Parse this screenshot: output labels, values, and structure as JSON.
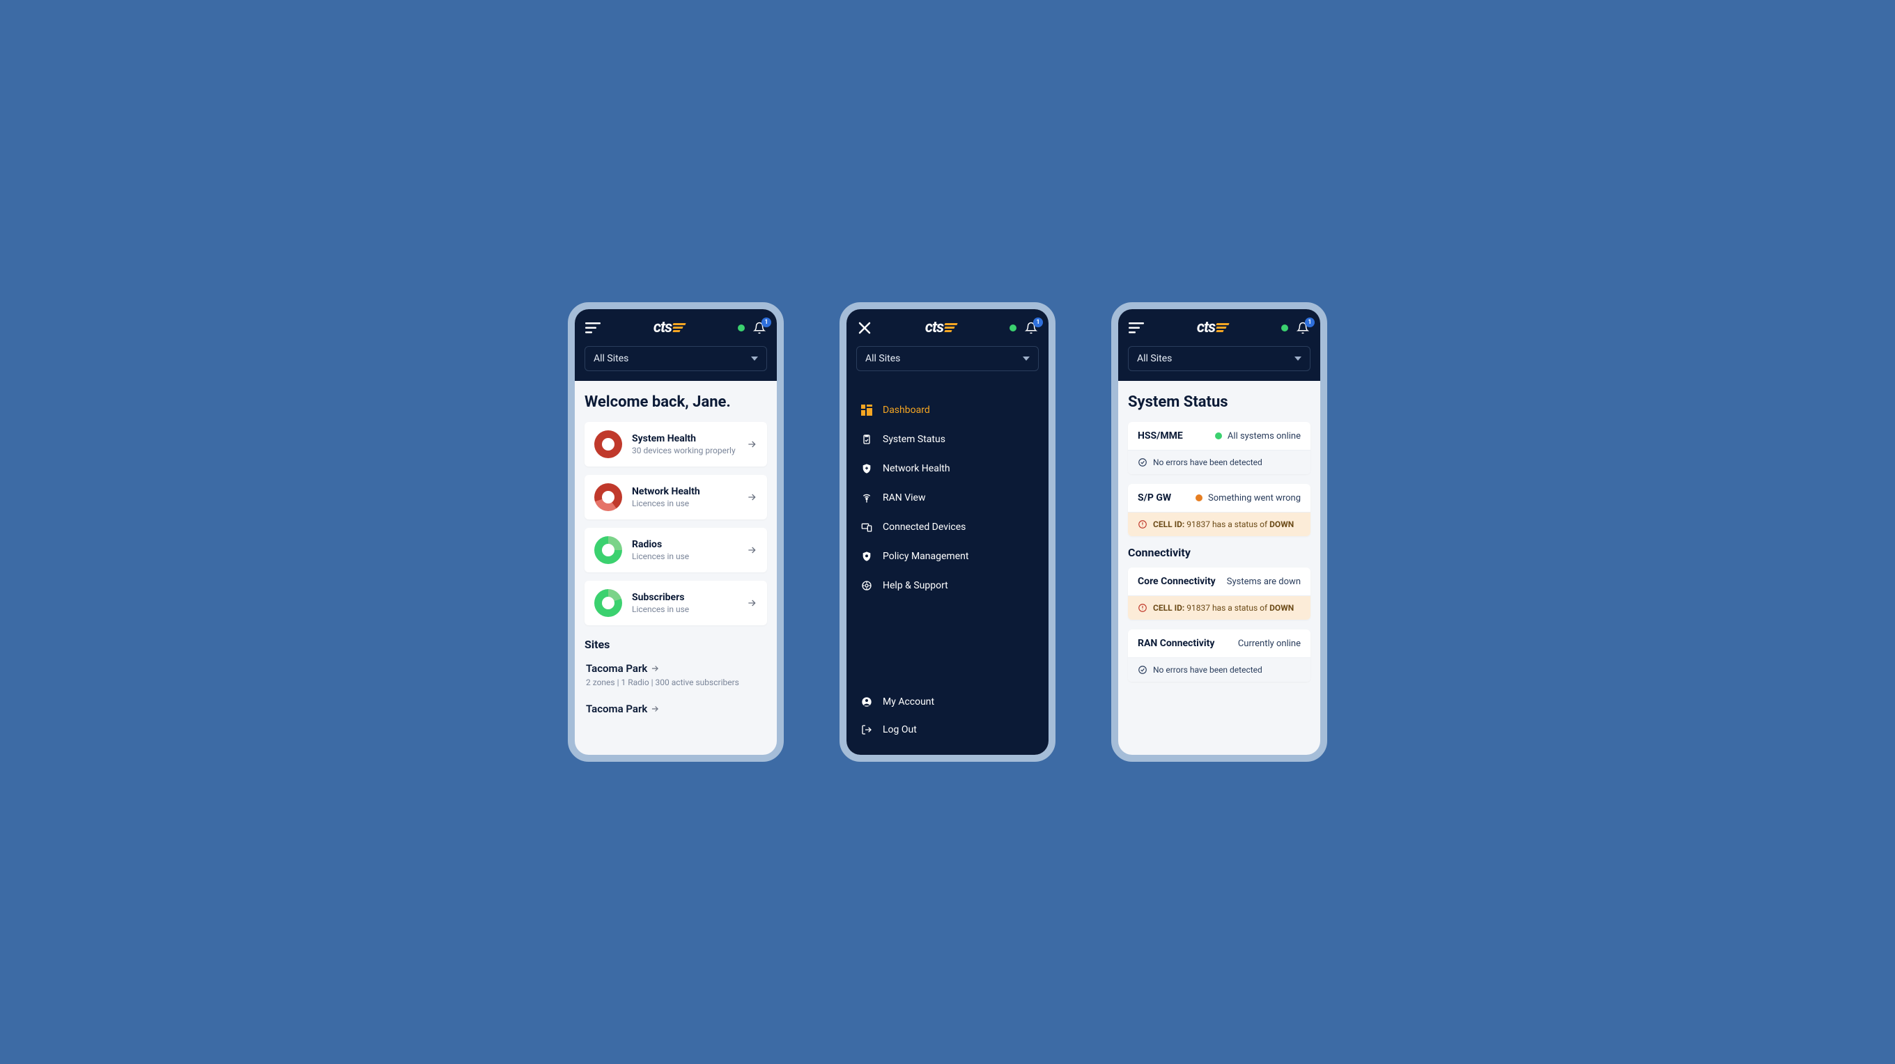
{
  "brand": "cts",
  "notification_count": "1",
  "site_select": {
    "label": "All Sites"
  },
  "dashboard": {
    "welcome": "Welcome back, Jane.",
    "cards": [
      {
        "title": "System Health",
        "sub": "30 devices working properly"
      },
      {
        "title": "Network Health",
        "sub": "Licences in use"
      },
      {
        "title": "Radios",
        "sub": "Licences in use"
      },
      {
        "title": "Subscribers",
        "sub": "Licences in use"
      }
    ],
    "sites_heading": "Sites",
    "sites": [
      {
        "name": "Tacoma Park",
        "sub": "2 zones  | 1 Radio  |  300 active subscribers"
      },
      {
        "name": "Tacoma Park",
        "sub": ""
      }
    ]
  },
  "nav": {
    "items": [
      {
        "label": "Dashboard"
      },
      {
        "label": "System Status"
      },
      {
        "label": "Network Health"
      },
      {
        "label": "RAN View"
      },
      {
        "label": "Connected Devices"
      },
      {
        "label": "Policy Management"
      },
      {
        "label": "Help & Support"
      }
    ],
    "bottom": [
      {
        "label": "My Account"
      },
      {
        "label": "Log Out"
      }
    ]
  },
  "status": {
    "title": "System Status",
    "groups": [
      {
        "name": "HSS/MME",
        "right": "All systems online",
        "color": "green",
        "bar": {
          "type": "ok",
          "text": "No errors have been detected"
        }
      },
      {
        "name": "S/P GW",
        "right": "Something went wrong",
        "color": "orange",
        "bar": {
          "type": "warn",
          "label": "CELL ID:",
          "text": "91837 has a status of",
          "bold": "DOWN"
        }
      }
    ],
    "connectivity_heading": "Connectivity",
    "connectivity": [
      {
        "name": "Core Connectivity",
        "right": "Systems are down",
        "bar": {
          "type": "warn",
          "label": "CELL ID:",
          "text": "91837 has a status of",
          "bold": "DOWN"
        }
      },
      {
        "name": "RAN Connectivity",
        "right": "Currently online",
        "bar": {
          "type": "ok",
          "text": "No errors have been detected"
        }
      }
    ]
  }
}
